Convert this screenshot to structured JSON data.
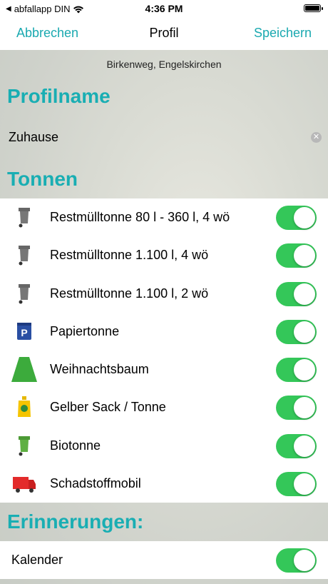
{
  "status_bar": {
    "carrier": "abfallapp DIN",
    "time": "4:36 PM"
  },
  "nav": {
    "cancel": "Abbrechen",
    "title": "Profil",
    "save": "Speichern"
  },
  "address": "Birkenweg, Engelskirchen",
  "profile": {
    "section_title": "Profilname",
    "name_value": "Zuhause"
  },
  "bins": {
    "section_title": "Tonnen",
    "items": [
      {
        "label": "Restmülltonne 80 l - 360 l, 4 wö",
        "icon": "gray-bin-icon",
        "enabled": true
      },
      {
        "label": "Restmülltonne 1.100 l, 4 wö",
        "icon": "gray-bin-icon",
        "enabled": true
      },
      {
        "label": "Restmülltonne 1.100 l, 2 wö",
        "icon": "gray-bin-icon",
        "enabled": true
      },
      {
        "label": "Papiertonne",
        "icon": "paper-bin-icon",
        "enabled": true
      },
      {
        "label": "Weihnachtsbaum",
        "icon": "christmas-tree-icon",
        "enabled": true
      },
      {
        "label": "Gelber Sack / Tonne",
        "icon": "yellow-bag-icon",
        "enabled": true
      },
      {
        "label": "Biotonne",
        "icon": "green-bin-icon",
        "enabled": true
      },
      {
        "label": "Schadstoffmobil",
        "icon": "red-truck-icon",
        "enabled": true
      }
    ]
  },
  "reminders": {
    "section_title": "Erinnerungen:",
    "calendar_label": "Kalender",
    "calendar_enabled": true
  },
  "colors": {
    "accent": "#19aeb3",
    "toggle_on": "#34c759"
  }
}
